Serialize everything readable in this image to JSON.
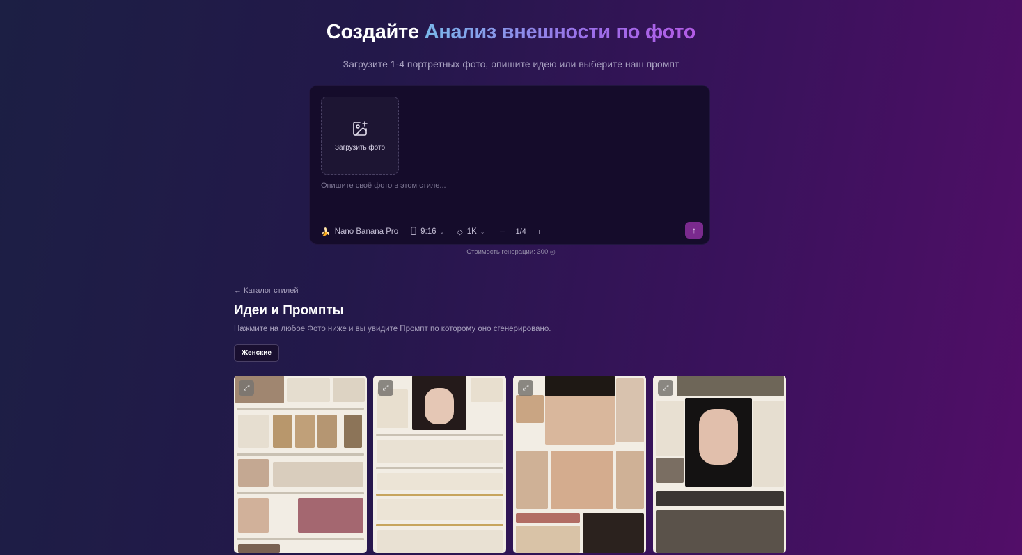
{
  "hero": {
    "title_prefix": "Создайте",
    "title_accent": "Анализ внешности по фото",
    "subtitle": "Загрузите 1-4 портретных фото, опишите идею или выберите наш промпт"
  },
  "composer": {
    "upload_label": "Загрузить фото",
    "prompt_placeholder": "Опишите своё фото в этом стиле...",
    "model": {
      "icon": "banana-icon",
      "label": "Nano Banana Pro"
    },
    "aspect": {
      "icon": "phone-icon",
      "label": "9:16"
    },
    "quality": {
      "icon": "diamond-icon",
      "label": "1K"
    },
    "count": {
      "value": "1/4"
    },
    "send_icon": "arrow-up-icon"
  },
  "cost": {
    "text": "Стоимость генерации: 300"
  },
  "catalog": {
    "back_label": "← Каталог стилей",
    "title": "Идеи и Промпты",
    "description": "Нажмите на любое Фото ниже и вы увидите Промпт по которому оно сгенерировано.",
    "filter_chip": "Женские"
  },
  "cards": [
    {
      "name": "card-1",
      "icon": "expand-icon"
    },
    {
      "name": "card-2",
      "icon": "expand-icon"
    },
    {
      "name": "card-3",
      "icon": "expand-icon"
    },
    {
      "name": "card-4",
      "icon": "expand-icon"
    }
  ],
  "colors": {
    "accent_gradient_start": "#7ab8ea",
    "accent_gradient_end": "#b35ce6",
    "send_button": "#7a2a8e"
  }
}
